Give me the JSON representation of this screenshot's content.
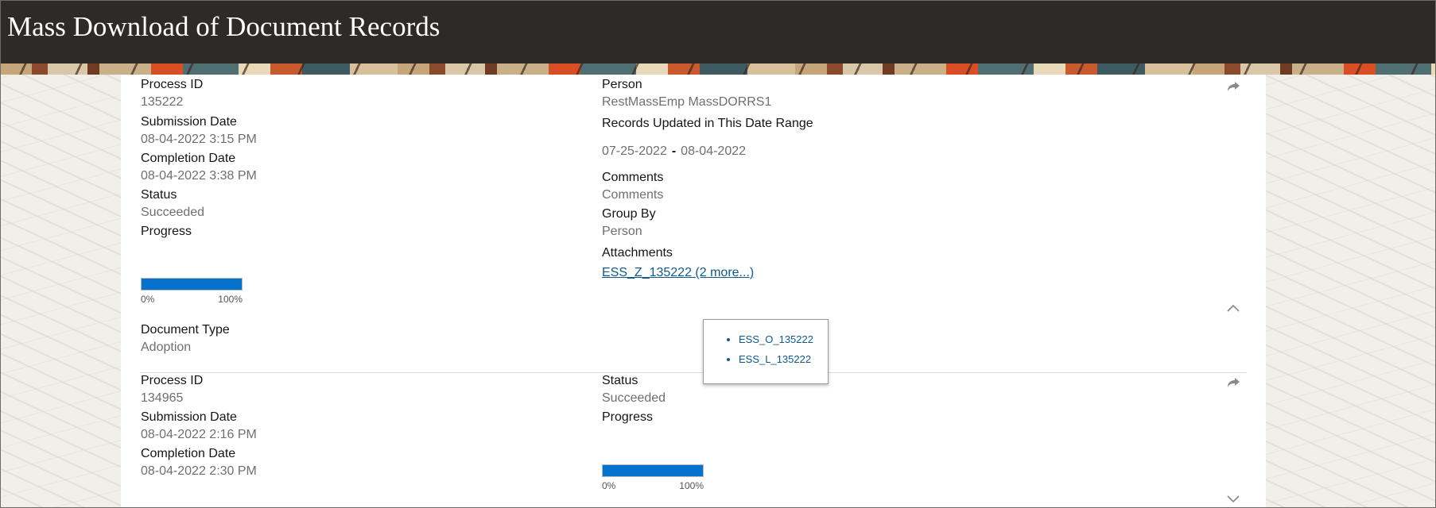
{
  "page": {
    "title": "Mass Download of Document Records"
  },
  "icons": {
    "refresh": "refresh-icon",
    "collapse": "chevron-up-icon",
    "expand": "chevron-down-icon"
  },
  "colors": {
    "progress": "#0572ce",
    "link": "#0e5a8a",
    "header": "#2e2a27"
  },
  "records": [
    {
      "process_id_label": "Process ID",
      "process_id": "135222",
      "submission_date_label": "Submission Date",
      "submission_date": "08-04-2022 3:15 PM",
      "completion_date_label": "Completion Date",
      "completion_date": "08-04-2022 3:38 PM",
      "status_label": "Status",
      "status": "Succeeded",
      "progress_label": "Progress",
      "progress_percent": 100,
      "progress_min": "0%",
      "progress_max": "100%",
      "document_type_label": "Document Type",
      "document_type": "Adoption",
      "person_label": "Person",
      "person": "RestMassEmp MassDORRS1",
      "date_range_label": "Records Updated in This Date Range",
      "date_from": "07-25-2022",
      "date_sep": "-",
      "date_to": "08-04-2022",
      "comments_label": "Comments",
      "comments": "Comments",
      "group_by_label": "Group By",
      "group_by": "Person",
      "attachments_label": "Attachments",
      "attachment_link": "ESS_Z_135222 (2 more...)",
      "more_attachments": [
        "ESS_O_135222",
        "ESS_L_135222"
      ]
    },
    {
      "process_id_label": "Process ID",
      "process_id": "134965",
      "submission_date_label": "Submission Date",
      "submission_date": "08-04-2022 2:16 PM",
      "completion_date_label": "Completion Date",
      "completion_date": "08-04-2022 2:30 PM",
      "status_label": "Status",
      "status": "Succeeded",
      "progress_label": "Progress",
      "progress_percent": 100,
      "progress_min": "0%",
      "progress_max": "100%"
    }
  ]
}
